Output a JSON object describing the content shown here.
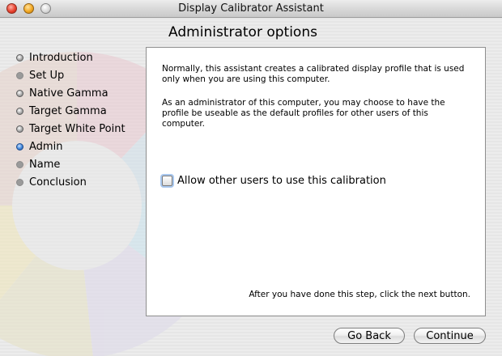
{
  "window": {
    "title": "Display Calibrator Assistant"
  },
  "heading": "Administrator options",
  "steps": [
    {
      "label": "Introduction",
      "state": "done"
    },
    {
      "label": "Set Up",
      "state": "todo"
    },
    {
      "label": "Native Gamma",
      "state": "done"
    },
    {
      "label": "Target Gamma",
      "state": "done"
    },
    {
      "label": "Target White Point",
      "state": "done"
    },
    {
      "label": "Admin",
      "state": "current"
    },
    {
      "label": "Name",
      "state": "todo"
    },
    {
      "label": "Conclusion",
      "state": "todo"
    }
  ],
  "content": {
    "para1": "Normally, this assistant creates a calibrated display profile that is used only when you are using this computer.",
    "para2": "As an administrator of this computer, you may choose to have the profile be useable as the default profiles for other users of this computer.",
    "checkbox_label": "Allow other users to use this calibration",
    "checkbox_checked": false,
    "hint": "After you have done this step, click the next button."
  },
  "buttons": {
    "back": "Go Back",
    "continue": "Continue"
  },
  "colors": {
    "current_step": "#4b8fe0",
    "accent_focus": "#a9c8ef"
  }
}
